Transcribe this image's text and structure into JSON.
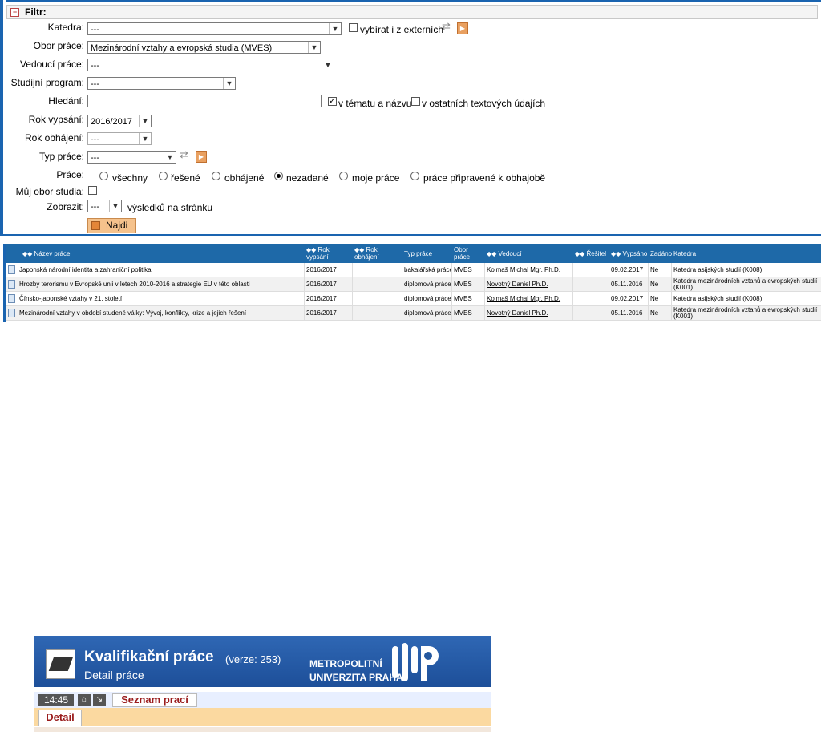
{
  "filter": {
    "header": "Filtr:",
    "toggle": "−",
    "katedra": {
      "label": "Katedra:",
      "value": "---"
    },
    "externi_label": "vybírat i z externích",
    "obor": {
      "label": "Obor práce:",
      "value": "Mezinárodní vztahy a evropská studia (MVES)"
    },
    "vedouci": {
      "label": "Vedoucí práce:",
      "value": "---"
    },
    "program": {
      "label": "Studijní program:",
      "value": "---"
    },
    "hledani": {
      "label": "Hledání:",
      "value": ""
    },
    "v_tematu_label": "v tématu a názvu",
    "v_ostatnich_label": "v ostatních textových údajích",
    "rok_vypsani": {
      "label": "Rok vypsání:",
      "value": "2016/2017"
    },
    "rok_obhajeni": {
      "label": "Rok obhájení:",
      "value": "---"
    },
    "typ": {
      "label": "Typ práce:",
      "value": "---"
    },
    "prace": {
      "label": "Práce:",
      "options": [
        "všechny",
        "řešené",
        "obhájené",
        "nezadané",
        "moje práce",
        "práce připravené k obhajobě"
      ],
      "selected": "nezadané"
    },
    "muj_obor_label": "Můj obor studia:",
    "zobrazit": {
      "label": "Zobrazit:",
      "value": "---",
      "suffix": "výsledků na stránku"
    },
    "search_button": "Najdi"
  },
  "table": {
    "headers": {
      "nazev": "◆◆ Název práce",
      "rok_vypsani": "◆◆ Rok vypsání",
      "rok_obhajeni": "◆◆ Rok obhájení",
      "typ": "Typ práce",
      "obor": "Obor práce",
      "vedouci": "◆◆ Vedoucí",
      "resitel": "◆◆ Řešitel",
      "vypsano": "◆◆ Vypsáno",
      "zadano": "Zadáno",
      "katedra": "Katedra"
    },
    "rows": [
      {
        "nazev": "Japonská národní identita a zahraniční politika",
        "rok_vypsani": "2016/2017",
        "rok_obhajeni": "",
        "typ": "bakalářská práce",
        "obor": "MVES",
        "vedouci": "Kolmaš Michal Mgr. Ph.D.",
        "resitel": "",
        "vypsano": "09.02.2017",
        "zadano": "Ne",
        "katedra": "Katedra asijských studií (K008)"
      },
      {
        "nazev": "Hrozby terorismu v Evropské unii v letech 2010-2016 a strategie EU v této oblasti",
        "rok_vypsani": "2016/2017",
        "rok_obhajeni": "",
        "typ": "diplomová práce",
        "obor": "MVES",
        "vedouci": "Novotný Daniel Ph.D.",
        "resitel": "",
        "vypsano": "05.11.2016",
        "zadano": "Ne",
        "katedra": "Katedra mezinárodních vztahů a evropských studií (K001)"
      },
      {
        "nazev": "Čínsko-japonské vztahy v 21. století",
        "rok_vypsani": "2016/2017",
        "rok_obhajeni": "",
        "typ": "diplomová práce",
        "obor": "MVES",
        "vedouci": "Kolmaš Michal Mgr. Ph.D.",
        "resitel": "",
        "vypsano": "09.02.2017",
        "zadano": "Ne",
        "katedra": "Katedra asijských studií (K008)"
      },
      {
        "nazev": "Mezinárodní vztahy v období studené války: Vývoj, konflikty, krize a jejich řešení",
        "rok_vypsani": "2016/2017",
        "rok_obhajeni": "",
        "typ": "diplomová práce",
        "obor": "MVES",
        "vedouci": "Novotný Daniel Ph.D.",
        "resitel": "",
        "vypsano": "05.11.2016",
        "zadano": "Ne",
        "katedra": "Katedra mezinárodních vztahů a evropských studií (K001)"
      }
    ]
  },
  "app": {
    "title": "Kvalifikační práce",
    "version": "(verze: 253)",
    "subtitle": "Detail práce",
    "university_line1": "METROPOLITNÍ",
    "university_line2": "UNIVERZITA PRAHA",
    "clock": "14:45",
    "tab_list": "Seznam prací",
    "tab_detail": "Detail",
    "home_icon": "home-icon",
    "exit_icon": "exit-icon",
    "colors": {
      "banner": "#2f67b4",
      "accent": "#9a1c1c",
      "tabbar": "#fbd9a0"
    }
  }
}
